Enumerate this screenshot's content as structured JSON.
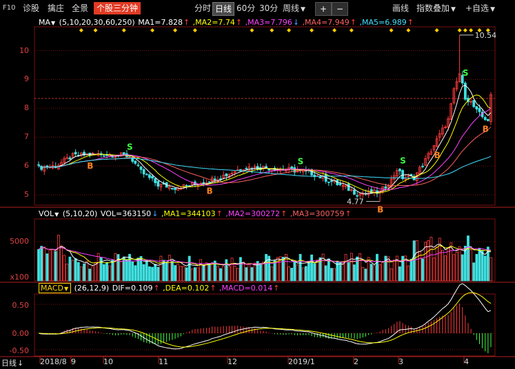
{
  "toolbar": {
    "f10": "F10",
    "diagnose": "诊股",
    "catch": "擒庄",
    "panorama": "全景",
    "three_min": "个股三分钟",
    "intraday": "分时",
    "daily": "日线",
    "min60": "60分",
    "min30": "30分",
    "weekly": "周线",
    "dropdown_arrow": "▼",
    "plus": "+",
    "minus": "−",
    "draw": "画线",
    "index_overlay": "指数叠加",
    "add_watch": "+自选"
  },
  "price_pane": {
    "indicator": "MA",
    "params": "(5,10,20,30,60,250)",
    "values": [
      {
        "label": "MA1=7.828",
        "arrow": "↑",
        "color": "#ffffff"
      },
      {
        "label": "MA2=7.74",
        "arrow": "↑",
        "color": "#ffff00"
      },
      {
        "label": "MA3=7.796",
        "arrow": "↓",
        "color": "#ff40ff"
      },
      {
        "label": "MA4=7.949",
        "arrow": "↑",
        "color": "#ff6060"
      },
      {
        "label": "MA5=6.989",
        "arrow": "↑",
        "color": "#40e0ff"
      }
    ],
    "axis_labels": [
      "10",
      "9",
      "8",
      "7",
      "6",
      "5"
    ],
    "high_label": "10.54",
    "low_label": "4.77",
    "buy_mark": "B",
    "sell_mark": "S"
  },
  "volume_pane": {
    "indicator": "VOL",
    "params": "(5,10,20)",
    "values": [
      {
        "label": "VOL=363150",
        "arrow": "↓",
        "color": "#ffffff"
      },
      {
        "label": "MA1=344103",
        "arrow": "↑",
        "color": "#ffff00"
      },
      {
        "label": "MA2=300272",
        "arrow": "↑",
        "color": "#ff40ff"
      },
      {
        "label": "MA3=300759",
        "arrow": "↑",
        "color": "#ff6060"
      }
    ],
    "axis_labels": [
      "5000"
    ],
    "unit": "x100"
  },
  "macd_pane": {
    "indicator": "MACD",
    "params": "(26,12,9)",
    "values": [
      {
        "label": "DIF=0.109",
        "arrow": "↑",
        "color": "#ffffff"
      },
      {
        "label": "DEA=0.102",
        "arrow": "↑",
        "color": "#ffff00"
      },
      {
        "label": "MACD=0.014",
        "arrow": "↑",
        "color": "#ff40ff"
      }
    ],
    "axis_labels": [
      "0.50",
      "0.00",
      "-0.50"
    ]
  },
  "date_axis": {
    "period": "日线",
    "period_arrow": "↓",
    "labels": [
      "2018/8",
      "9",
      "10",
      "11",
      "12",
      "2019/1",
      "2",
      "3",
      "4"
    ]
  },
  "colors": {
    "up": "#ff3c3c",
    "down": "#40e0e0",
    "grid": "#7a1010",
    "axis_text": "#e04040",
    "highlight": "#e23b24"
  }
}
